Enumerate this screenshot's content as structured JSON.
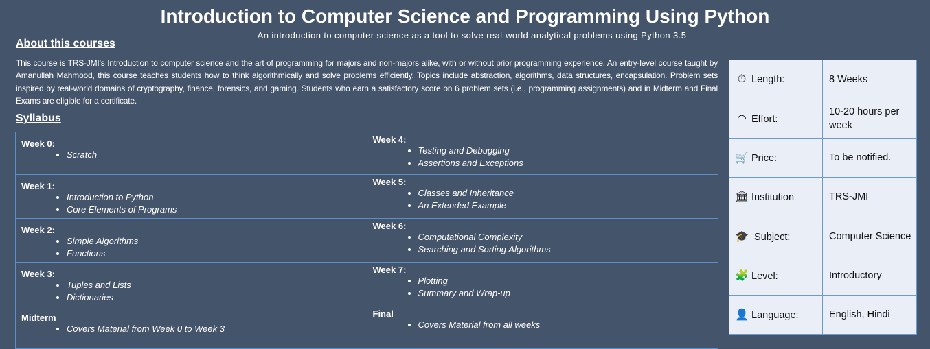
{
  "header": {
    "title": "Introduction to Computer Science and Programming Using Python",
    "subtitle": "An introduction to computer science as a tool to solve real-world analytical problems using Python 3.5"
  },
  "about": {
    "heading": "About this courses",
    "text": "This course is TRS-JMI’s Introduction to computer science and the art of programming for majors and non-majors alike, with or without prior programming experience. An entry-level course taught by Amanullah Mahmood, this course teaches students how to think algorithmically and solve problems efficiently. Topics include abstraction, algorithms, data structures, encapsulation. Problem sets inspired by real-world domains of cryptography, finance, forensics, and gaming. Students who earn a satisfactory score on 6 problem sets (i.e., programming assignments) and in Midterm and Final Exams are eligible for a certificate."
  },
  "syllabus": {
    "heading": "Syllabus",
    "cells": [
      {
        "title": "Week 0:",
        "items": [
          "Scratch"
        ]
      },
      {
        "title": "Week 4:",
        "items": [
          "Testing and Debugging",
          "Assertions and Exceptions"
        ]
      },
      {
        "title": "Week 1:",
        "items": [
          "Introduction to Python",
          "Core Elements of Programs"
        ]
      },
      {
        "title": "Week 5:",
        "items": [
          "Classes and Inheritance",
          "An Extended Example"
        ]
      },
      {
        "title": "Week 2:",
        "items": [
          "Simple Algorithms",
          "Functions"
        ]
      },
      {
        "title": "Week 6:",
        "items": [
          "Computational Complexity",
          "Searching and Sorting Algorithms"
        ]
      },
      {
        "title": "Week 3:",
        "items": [
          "Tuples and Lists",
          "Dictionaries"
        ]
      },
      {
        "title": "Week 7:",
        "items": [
          "Plotting",
          "Summary and Wrap-up"
        ]
      },
      {
        "title": "Midterm",
        "items": [
          "Covers Material from Week 0 to Week 3"
        ]
      },
      {
        "title": "Final",
        "items": [
          "Covers Material from all weeks"
        ]
      }
    ]
  },
  "info": [
    {
      "icon": "stopwatch-icon",
      "glyph": "⏱",
      "label": "Length:",
      "value": "8 Weeks"
    },
    {
      "icon": "speedometer-icon",
      "glyph": "◠",
      "label": "Effort:",
      "value": "10-20 hours per week"
    },
    {
      "icon": "cart-icon",
      "glyph": "🛒",
      "label": "Price:",
      "value": "To be notified."
    },
    {
      "icon": "institution-icon",
      "glyph": "🏛",
      "label": "Institution",
      "value": "TRS-JMI"
    },
    {
      "icon": "graduation-cap-icon",
      "glyph": "🎓",
      "label": " Subject:",
      "value": "Computer Science"
    },
    {
      "icon": "puzzle-icon",
      "glyph": "🧩",
      "label": "Level:",
      "value": "Introductory"
    },
    {
      "icon": "speaker-person-icon",
      "glyph": "👤",
      "label": "Language:",
      "value": "English, Hindi"
    }
  ]
}
